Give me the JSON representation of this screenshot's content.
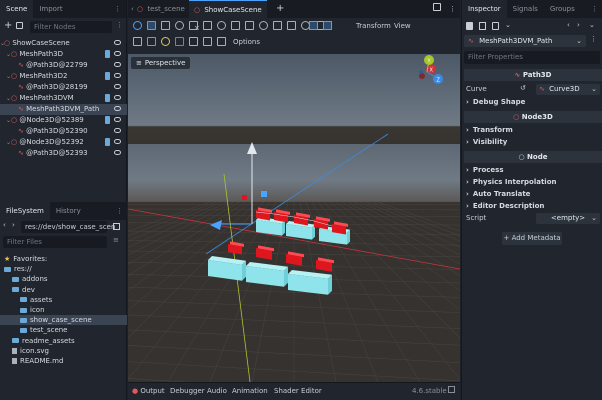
{
  "scene_tabs": {
    "scene": "Scene",
    "import": "Import"
  },
  "scene_dock": {
    "filter_placeholder": "Filter Nodes"
  },
  "tree": [
    {
      "label": "ShowCaseScene",
      "indent": 0,
      "type": "node3d"
    },
    {
      "label": "MeshPath3D",
      "indent": 1,
      "type": "node3d"
    },
    {
      "label": "@Path3D@22799",
      "indent": 2,
      "type": "path"
    },
    {
      "label": "MeshPath3D2",
      "indent": 1,
      "type": "node3d"
    },
    {
      "label": "@Path3D@28199",
      "indent": 2,
      "type": "path"
    },
    {
      "label": "MeshPath3DVM",
      "indent": 1,
      "type": "node3d"
    },
    {
      "label": "MeshPath3DVM_Path",
      "indent": 2,
      "type": "path",
      "selected": true
    },
    {
      "label": "@Node3D@52389",
      "indent": 1,
      "type": "node3d"
    },
    {
      "label": "@Path3D@52390",
      "indent": 2,
      "type": "path"
    },
    {
      "label": "@Node3D@52392",
      "indent": 1,
      "type": "node3d"
    },
    {
      "label": "@Path3D@52393",
      "indent": 2,
      "type": "path"
    }
  ],
  "fs_tabs": {
    "filesystem": "FileSystem",
    "history": "History"
  },
  "fs_path": "res://dev/show_case_scen",
  "fs_filter_placeholder": "Filter Files",
  "fs": [
    {
      "label": "Favorites:",
      "indent": 0,
      "kind": "star"
    },
    {
      "label": "res://",
      "indent": 0,
      "kind": "folder"
    },
    {
      "label": "addons",
      "indent": 1,
      "kind": "folder"
    },
    {
      "label": "dev",
      "indent": 1,
      "kind": "folder"
    },
    {
      "label": "assets",
      "indent": 2,
      "kind": "folder"
    },
    {
      "label": "icon",
      "indent": 2,
      "kind": "folder"
    },
    {
      "label": "show_case_scene",
      "indent": 2,
      "kind": "folder",
      "selected": true
    },
    {
      "label": "test_scene",
      "indent": 2,
      "kind": "folder"
    },
    {
      "label": "readme_assets",
      "indent": 1,
      "kind": "folder"
    },
    {
      "label": "icon.svg",
      "indent": 1,
      "kind": "file"
    },
    {
      "label": "README.md",
      "indent": 1,
      "kind": "file"
    }
  ],
  "editor_tabs": [
    {
      "label": "test_scene",
      "active": false
    },
    {
      "label": "ShowCaseScene",
      "active": true
    }
  ],
  "toolbar": {
    "transform": "Transform",
    "view": "View",
    "options": "Options"
  },
  "viewport": {
    "perspective": "Perspective",
    "gizmo": {
      "x": "X",
      "y": "Y",
      "z": "Z"
    }
  },
  "bottom": {
    "output": "Output",
    "debugger": "Debugger",
    "audio": "Audio",
    "animation": "Animation",
    "shader_editor": "Shader Editor",
    "version": "4.6.stable"
  },
  "inspector_tabs": {
    "inspector": "Inspector",
    "signals": "Signals",
    "groups": "Groups"
  },
  "inspector": {
    "node": "MeshPath3DVM_Path",
    "filter_placeholder": "Filter Properties",
    "class_path": "Path3D",
    "curve_label": "Curve",
    "curve_value": "Curve3D",
    "debug_shape": "Debug Shape",
    "class_node3d": "Node3D",
    "transform": "Transform",
    "visibility": "Visibility",
    "class_node": "Node",
    "process": "Process",
    "physics_interp": "Physics Interpolation",
    "auto_translate": "Auto Translate",
    "editor_desc": "Editor Description",
    "script_label": "Script",
    "script_value": "<empty>",
    "add_metadata": "Add Metadata"
  },
  "colors": {
    "accent": "#4aa3ff",
    "node_red": "#e05a5a",
    "axis_red": "#c8353c",
    "axis_blue": "#3d8be0",
    "axis_green": "#a6c72c",
    "mesh": "#8fe3ea",
    "cube": "#e0161f",
    "bg": "#21262e"
  }
}
